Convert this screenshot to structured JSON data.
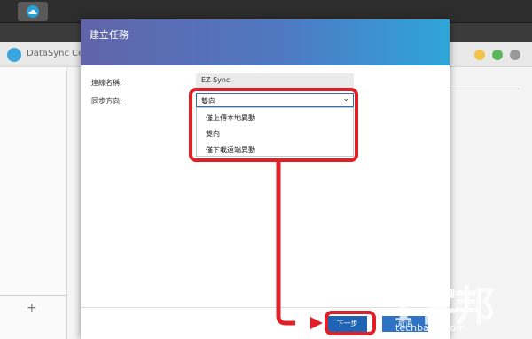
{
  "background_window": {
    "title": "DataSync Cente",
    "add_symbol": "+"
  },
  "dialog": {
    "title": "建立任務",
    "name_label": "連線名稱:",
    "name_value": "EZ Sync",
    "direction_label": "同步方向:",
    "direction_selected": "雙向",
    "direction_options": [
      "僅上傳本地異動",
      "雙向",
      "僅下載遠端異動"
    ],
    "next_button": "下一步",
    "cancel_button": "取消"
  },
  "watermark": {
    "big": "T客邦",
    "small": "techbang.com"
  },
  "colors": {
    "annotation": "#e21f26",
    "primary_button": "#1f63b4",
    "title_gradient_start": "#6164a8",
    "title_gradient_end": "#2ea5d8"
  }
}
